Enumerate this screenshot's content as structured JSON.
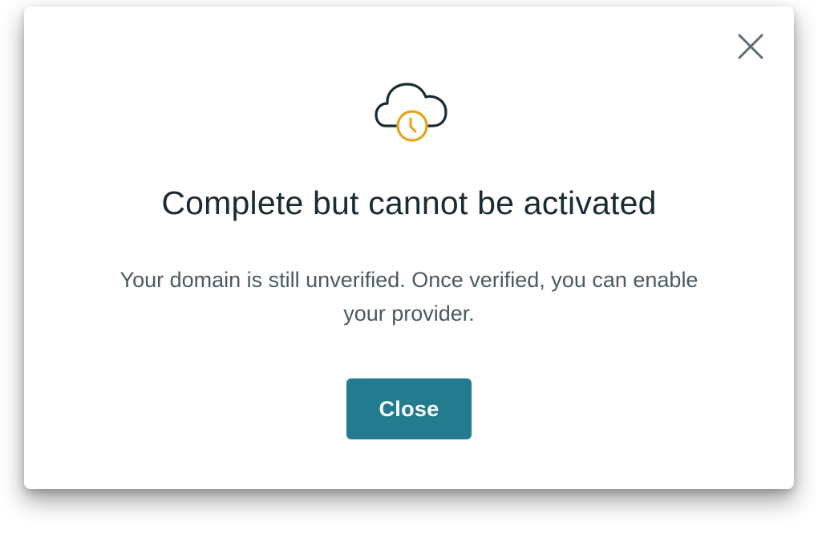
{
  "dialog": {
    "title": "Complete but cannot be activated",
    "message": "Your domain is still unverified. Once verified, you can enable your provider.",
    "close_button_label": "Close",
    "icons": {
      "hero": "cloud-clock-icon",
      "dismiss": "close-icon"
    }
  },
  "colors": {
    "primary_button": "#237b8f",
    "title_text": "#1b2b33",
    "body_text": "#4a5a63",
    "icon_outline": "#1b2b33",
    "icon_accent": "#e8a317",
    "close_icon": "#5f6b73"
  }
}
